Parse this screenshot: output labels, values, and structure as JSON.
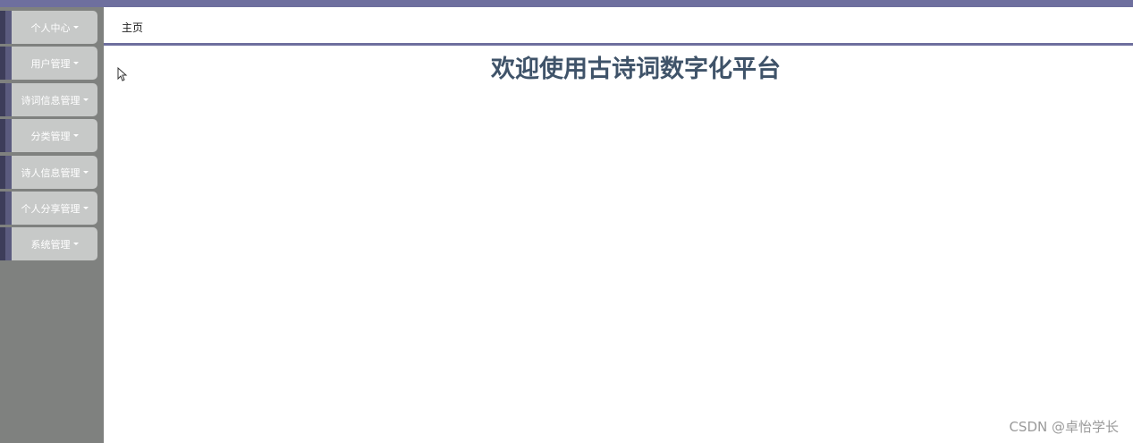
{
  "sidebar": {
    "items": [
      {
        "label": "个人中心"
      },
      {
        "label": "用户管理"
      },
      {
        "label": "诗词信息管理"
      },
      {
        "label": "分类管理"
      },
      {
        "label": "诗人信息管理"
      },
      {
        "label": "个人分享管理"
      },
      {
        "label": "系统管理"
      }
    ]
  },
  "breadcrumb": {
    "home_label": "主页"
  },
  "main": {
    "welcome_title": "欢迎使用古诗词数字化平台"
  },
  "watermark": {
    "text": "CSDN @卓怡学长"
  },
  "colors": {
    "topbar": "#6e6f9e",
    "sidebar_bg": "#7f817f",
    "menu_button": "#c7c9c8",
    "welcome_text": "#3f5369"
  },
  "icons": {
    "menu_caret": "chevron-down-icon",
    "pointer": "mouse-cursor-icon"
  }
}
